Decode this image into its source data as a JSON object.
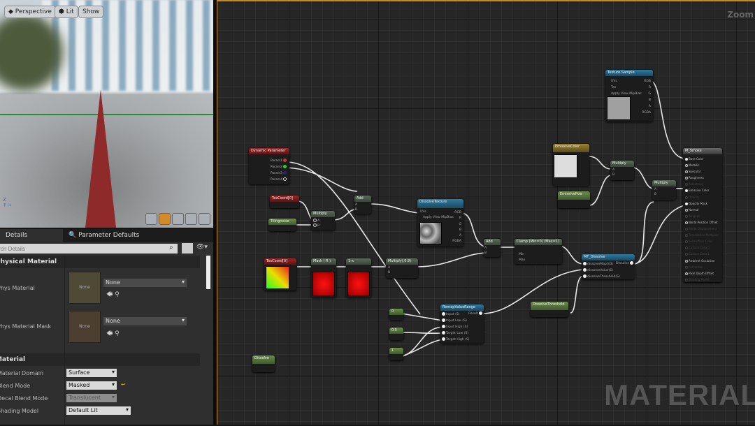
{
  "viewport": {
    "perspective_label": "Perspective",
    "lit_label": "Lit",
    "show_label": "Show"
  },
  "details": {
    "tabs": [
      "Details",
      "Parameter Defaults"
    ],
    "search_placeholder": "Search Details",
    "sections": {
      "physical": "Physical Material",
      "material": "Material"
    },
    "phys_material": {
      "label": "Phys Material",
      "thumb": "None",
      "value": "None"
    },
    "phys_material_mask": {
      "label": "Phys Material Mask",
      "thumb": "None",
      "value": "None"
    },
    "material_domain": {
      "label": "Material Domain",
      "value": "Surface"
    },
    "blend_mode": {
      "label": "Blend Mode",
      "value": "Masked"
    },
    "decal_blend_mode": {
      "label": "Decal Blend Mode",
      "value": "Translucent"
    },
    "shading_model": {
      "label": "Shading Model",
      "value": "Default Lit"
    }
  },
  "graph": {
    "zoom_label": "Zoom",
    "watermark": "MATERIAL",
    "nodes": {
      "dynamic_parameter": {
        "title": "Dynamic Parameter",
        "outputs": [
          "Param1",
          "Param2",
          "Param3",
          "Param4"
        ]
      },
      "texcoord1": {
        "title": "TexCoord[0]"
      },
      "tilingnoise": {
        "title": "Tilingnoise"
      },
      "multiply1": {
        "title": "Multiply",
        "inputs": [
          "A",
          "B"
        ]
      },
      "add1": {
        "title": "Add",
        "inputs": [
          "A",
          "B"
        ]
      },
      "dissolve_texture": {
        "title": "DissolveTexture",
        "inputs": [
          "UVs",
          "Apply View MipBias"
        ],
        "outputs": [
          "RGB",
          "R",
          "G",
          "B",
          "A",
          "RGBA"
        ]
      },
      "texcoord2": {
        "title": "TexCoord[0]"
      },
      "mask": {
        "title": "Mask ( R )"
      },
      "one_minus": {
        "title": "1-x"
      },
      "multiply2": {
        "title": "Multiply(,0.9)",
        "inputs": [
          "A",
          "B"
        ]
      },
      "add2": {
        "title": "Add",
        "inputs": [
          "A",
          "B"
        ]
      },
      "clamp": {
        "title": "Clamp (Min=0) (Max=1)",
        "inputs": [
          "Min",
          "Max"
        ]
      },
      "mf_dissolve": {
        "title": "MF_Dissolve",
        "inputs": [
          "dissolveMap(V3)",
          "dissolveValue(S)",
          "dissolveThreshold(S)"
        ],
        "output": "Dissolve"
      },
      "texture_sample": {
        "title": "Texture Sample",
        "inputs": [
          "UVs",
          "Tex",
          "Apply View MipBias"
        ],
        "outputs": [
          "RGB",
          "R",
          "G",
          "B",
          "A",
          "RGBA"
        ]
      },
      "emissive_color": {
        "title": "EmissiveColor"
      },
      "emissive_pow": {
        "title": "EmissivePow"
      },
      "multiply3": {
        "title": "Multiply",
        "inputs": [
          "A",
          "B"
        ]
      },
      "multiply4": {
        "title": "Multiply",
        "inputs": [
          "A",
          "B"
        ]
      },
      "m_smoke": {
        "title": "M_Smoke",
        "pins": [
          {
            "name": "Base Color",
            "on": true
          },
          {
            "name": "Metallic",
            "on": true
          },
          {
            "name": "Specular",
            "on": true
          },
          {
            "name": "Roughness",
            "on": true
          },
          {
            "name": "Anisotropy",
            "on": false
          },
          {
            "name": "Emissive Color",
            "on": true
          },
          {
            "name": "Opacity",
            "on": false
          },
          {
            "name": "Opacity Mask",
            "on": true
          },
          {
            "name": "Normal",
            "on": true
          },
          {
            "name": "Tangent",
            "on": false
          },
          {
            "name": "World Position Offset",
            "on": true
          },
          {
            "name": "World Displacement",
            "on": false
          },
          {
            "name": "Tessellation Multiplier",
            "on": false
          },
          {
            "name": "Subsurface Color",
            "on": false
          },
          {
            "name": "Custom Data 0",
            "on": false
          },
          {
            "name": "Custom Data 1",
            "on": false
          },
          {
            "name": "Ambient Occlusion",
            "on": true
          },
          {
            "name": "Refraction",
            "on": false
          },
          {
            "name": "Pixel Depth Offset",
            "on": true
          },
          {
            "name": "Shading Model",
            "on": false
          }
        ]
      },
      "remap": {
        "title": "RemapValueRange",
        "inputs": [
          "Input (S)",
          "Input Low (S)",
          "Input High (S)",
          "Target Low (S)",
          "Target High (S)"
        ],
        "output": "Result"
      },
      "const0": {
        "title": "0"
      },
      "const05": {
        "title": "0.5"
      },
      "const1": {
        "title": "1"
      },
      "dissolve_threshold": {
        "title": "DissolveThreshold"
      },
      "dissolve": {
        "title": "Dissolve"
      }
    }
  },
  "colors": {
    "accent": "#c48a20",
    "param_red": "#a02525",
    "param_green": "#6b8e4a",
    "texture_blue": "#2e7aa0"
  }
}
